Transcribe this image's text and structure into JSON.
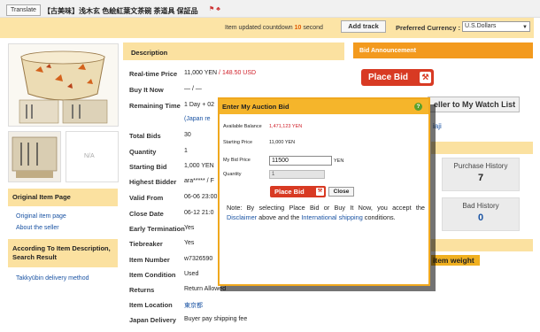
{
  "topbar": {
    "translate": "Translate",
    "title": "【古美味】浅木玄 色絵紅葉文茶碗 茶道具 保証品",
    "icons": "⚑ ♣"
  },
  "toolbar": {
    "countdown_prefix": "Item updated countdown",
    "countdown_num": "10",
    "countdown_suffix": "second",
    "add_track": "Add track",
    "currency_label": "Preferred Currency :",
    "currency_value": "U.S.Dollars"
  },
  "left": {
    "na": "N/A",
    "original_heading": "Original Item Page",
    "original_link": "Original item page",
    "seller_link": "About the seller",
    "result_heading_1": "According To Item Description,",
    "result_heading_2": "Search Result",
    "delivery_link": "Takkyūbin delivery method"
  },
  "description": {
    "heading": "Description",
    "rows": [
      {
        "label": "Real-time Price",
        "value": "11,000 YEN",
        "extra": " / 148.50 USD"
      },
      {
        "label": "Buy It Now",
        "value": "— / —",
        "extra": ""
      },
      {
        "label": "Remaining Time",
        "value": "1 Day + 02",
        "extra": ""
      },
      {
        "label": "",
        "value": "(Japan re",
        "extra": ""
      },
      {
        "label": "Total Bids",
        "value": "30",
        "extra": ""
      },
      {
        "label": "Quantity",
        "value": "1",
        "extra": ""
      },
      {
        "label": "Starting Bid",
        "value": "1,000 YEN",
        "extra": ""
      },
      {
        "label": "Highest Bidder",
        "value": "ara***** / F",
        "extra": ""
      },
      {
        "label": "Valid From",
        "value": "06-06 23:00",
        "extra": ""
      },
      {
        "label": "Close Date",
        "value": "06-12 21:0",
        "extra": ""
      },
      {
        "label": "Early Termination",
        "value": "Yes",
        "extra": ""
      },
      {
        "label": "Tiebreaker",
        "value": "Yes",
        "extra": ""
      },
      {
        "label": "Item Number",
        "value": "w7326590",
        "extra": ""
      },
      {
        "label": "Item Condition",
        "value": "Used",
        "extra": ""
      },
      {
        "label": "Returns",
        "value": "Return Allowed",
        "extra": ""
      },
      {
        "label": "Item Location",
        "value": "東京都",
        "extra": ""
      },
      {
        "label": "Japan Delivery",
        "value": "Buyer pay shipping fee",
        "extra": ""
      }
    ]
  },
  "right": {
    "bid_announcement": "Bid Announcement",
    "place_bid": "Place Bid",
    "watch_list": "eller to My Watch List",
    "seller": "iaji",
    "purchase_history_label": "Purchase History",
    "purchase_history_value": "7",
    "bad_history_label": "Bad History",
    "bad_history_value": "0",
    "item_weight": "item weight"
  },
  "modal": {
    "title": "Enter My Auction Bid",
    "help": "?",
    "balance_label": "Available Balance",
    "balance_value": "1,471,123 YEN",
    "starting_label": "Starting Price",
    "starting_value": "11,000 YEN",
    "bid_label": "My Bid Price",
    "bid_value": "11500",
    "bid_unit": "YEN",
    "qty_label": "Quantity",
    "qty_value": "1",
    "place_bid": "Place Bid",
    "close": "Close",
    "note_1": "Note: By selecting Place Bid or Buy It Now, you accept the",
    "note_disclaimer": "Disclaimer",
    "note_2": "above and the",
    "note_shipping": "International shipping",
    "note_3": "conditions."
  },
  "colors": {
    "accent_orange": "#f39a1e",
    "pale_orange": "#fbe1a0",
    "price_red": "#d0202a",
    "link_blue": "#1a53a3",
    "bid_button": "#d83a23"
  }
}
